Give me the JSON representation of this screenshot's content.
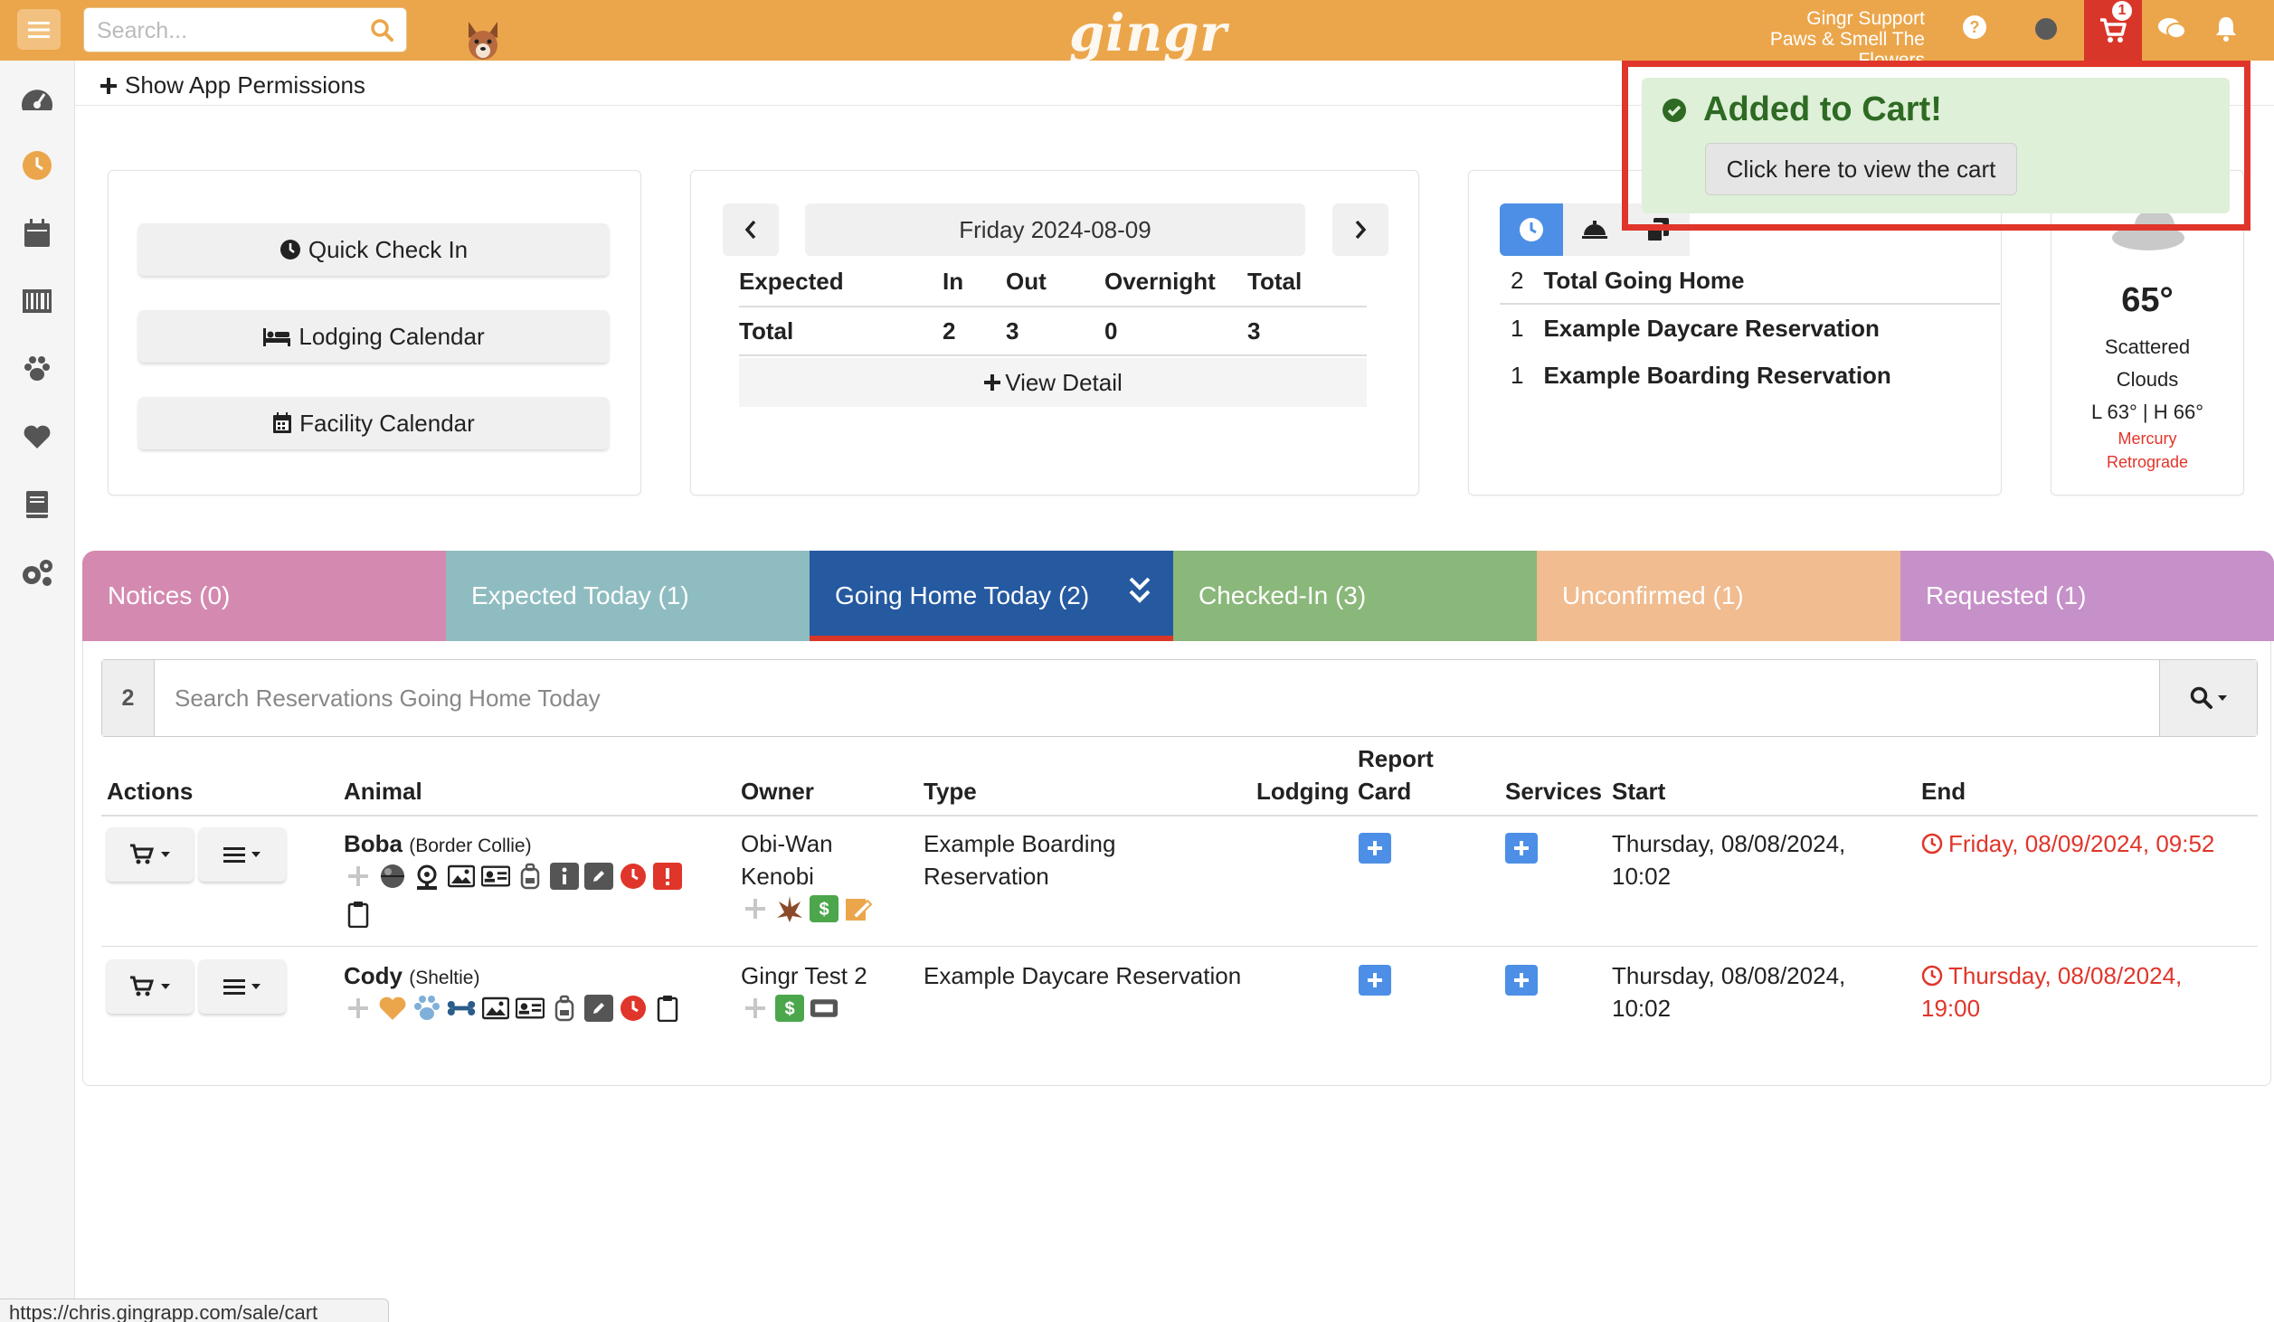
{
  "header": {
    "search_placeholder": "Search...",
    "logo": "gingr",
    "user_name": "Gingr Support",
    "location": "Paws & Smell The Flowers",
    "cart_count": "1"
  },
  "subheader": {
    "show_permissions": "Show App Permissions"
  },
  "quick_actions": {
    "check_in": "Quick Check In",
    "lodging_calendar": "Lodging Calendar",
    "facility_calendar": "Facility Calendar"
  },
  "summary": {
    "date": "Friday 2024-08-09",
    "headers": [
      "Expected",
      "In",
      "Out",
      "Overnight",
      "Total"
    ],
    "row": [
      "Total",
      "2",
      "3",
      "0",
      "3"
    ],
    "view_detail": "View Detail"
  },
  "going_home": {
    "rows": [
      {
        "count": "2",
        "label": "Total Going Home"
      },
      {
        "count": "1",
        "label": "Example Daycare Reservation"
      },
      {
        "count": "1",
        "label": "Example Boarding Reservation"
      }
    ]
  },
  "weather": {
    "temp": "65°",
    "condition_1": "Scattered",
    "condition_2": "Clouds",
    "range": "L 63° | H 66°",
    "note_1": "Mercury",
    "note_2": "Retrograde"
  },
  "notification": {
    "title": "Added to Cart!",
    "button": "Click here to view the cart",
    "colors": {
      "background": "#def0d8",
      "title": "#2e6a23",
      "outline": "#e0352a"
    }
  },
  "tabs": [
    {
      "label": "Notices (0)",
      "color": "#d48ab0"
    },
    {
      "label": "Expected Today (1)",
      "color": "#8fbcc0"
    },
    {
      "label": "Going Home Today (2)",
      "color": "#2559a0",
      "active": true
    },
    {
      "label": "Checked-In (3)",
      "color": "#8ab77a"
    },
    {
      "label": "Unconfirmed (1)",
      "color": "#f0bc90"
    },
    {
      "label": "Requested (1)",
      "color": "#c690c9"
    }
  ],
  "reservations": {
    "count": "2",
    "search_placeholder": "Search Reservations Going Home Today",
    "columns": {
      "actions": "Actions",
      "animal": "Animal",
      "owner": "Owner",
      "type": "Type",
      "lodging": "Lodging",
      "report_card_1": "Report",
      "report_card_2": "Card",
      "services": "Services",
      "start": "Start",
      "end": "End"
    },
    "rows": [
      {
        "animal_name": "Boba",
        "breed": "(Border Collie)",
        "owner_1": "Obi-Wan",
        "owner_2": "Kenobi",
        "type_1": "Example Boarding",
        "type_2": "Reservation",
        "start_1": "Thursday, 08/08/2024,",
        "start_2": "10:02",
        "end_1": "Friday, 08/09/2024, 09:52",
        "end_2": ""
      },
      {
        "animal_name": "Cody",
        "breed": "(Sheltie)",
        "owner_1": "Gingr Test 2",
        "owner_2": "",
        "type_1": "Example Daycare Reservation",
        "type_2": "",
        "start_1": "Thursday, 08/08/2024,",
        "start_2": "10:02",
        "end_1": "Thursday, 08/08/2024,",
        "end_2": "19:00"
      }
    ]
  },
  "status_url": "https://chris.gingrapp.com/sale/cart"
}
